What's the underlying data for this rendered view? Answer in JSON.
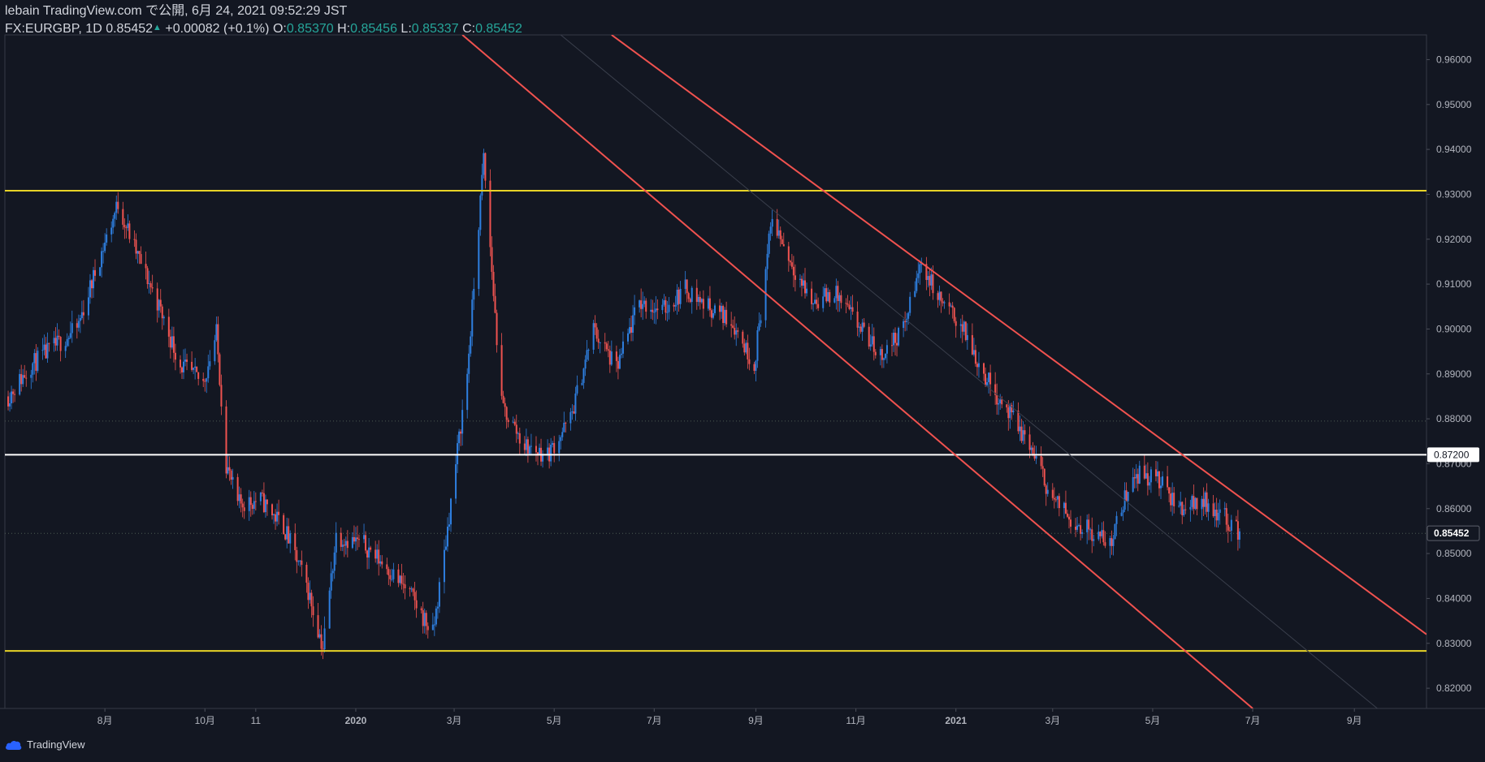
{
  "header": {
    "line1": "lebain TradingView.com で公開, 6月 24, 2021 09:52:29 JST",
    "symbol": "FX:EURGBP, 1D",
    "last": "0.85452",
    "change": "+0.00082 (+0.1%)",
    "o_label": "O:",
    "o": "0.85370",
    "h_label": "H:",
    "h": "0.85456",
    "l_label": "L:",
    "l": "0.85337",
    "c_label": "C:",
    "c": "0.85452"
  },
  "footer": {
    "brand": "TradingView"
  },
  "colors": {
    "background": "#131722",
    "up": "#2e7fe0",
    "down": "#ef5350",
    "support_resistance": "#e7d327",
    "channel": "#f0524f",
    "level_line": "#ffffff",
    "axis_text": "#b2b5be",
    "change_text": "#26a69a"
  },
  "chart_data": {
    "type": "candlestick",
    "instrument": "FX:EURGBP",
    "timeframe": "1D",
    "ylim": [
      0.8155,
      0.9655
    ],
    "y_ticks": [
      "0.96000",
      "0.95000",
      "0.94000",
      "0.93000",
      "0.92000",
      "0.91000",
      "0.90000",
      "0.89000",
      "0.88000",
      "0.87000",
      "0.86000",
      "0.85000",
      "0.84000",
      "0.83000",
      "0.82000"
    ],
    "x_ticks": [
      {
        "label": "8月",
        "date": "2019-08-01"
      },
      {
        "label": "10月",
        "date": "2019-10-01"
      },
      {
        "label": "11",
        "date": "2019-11-01"
      },
      {
        "label": "2020",
        "date": "2020-01-01"
      },
      {
        "label": "3月",
        "date": "2020-03-01"
      },
      {
        "label": "5月",
        "date": "2020-05-01"
      },
      {
        "label": "7月",
        "date": "2020-07-01"
      },
      {
        "label": "9月",
        "date": "2020-09-01"
      },
      {
        "label": "11月",
        "date": "2020-11-01"
      },
      {
        "label": "2021",
        "date": "2021-01-01"
      },
      {
        "label": "3月",
        "date": "2021-03-01"
      },
      {
        "label": "5月",
        "date": "2021-05-01"
      },
      {
        "label": "7月",
        "date": "2021-07-01"
      },
      {
        "label": "9月",
        "date": "2021-09-01"
      }
    ],
    "x_range": [
      "2019-06-01",
      "2021-10-15"
    ],
    "series": [
      {
        "date": "2019-06-03",
        "close": 0.885
      },
      {
        "date": "2019-06-17",
        "close": 0.892
      },
      {
        "date": "2019-07-01",
        "close": 0.896
      },
      {
        "date": "2019-07-15",
        "close": 0.9
      },
      {
        "date": "2019-07-29",
        "close": 0.916
      },
      {
        "date": "2019-08-09",
        "close": 0.928
      },
      {
        "date": "2019-08-19",
        "close": 0.918
      },
      {
        "date": "2019-09-02",
        "close": 0.906
      },
      {
        "date": "2019-09-16",
        "close": 0.892
      },
      {
        "date": "2019-09-30",
        "close": 0.888
      },
      {
        "date": "2019-10-08",
        "close": 0.899
      },
      {
        "date": "2019-10-14",
        "close": 0.87
      },
      {
        "date": "2019-10-21",
        "close": 0.861
      },
      {
        "date": "2019-11-04",
        "close": 0.862
      },
      {
        "date": "2019-11-18",
        "close": 0.856
      },
      {
        "date": "2019-12-02",
        "close": 0.843
      },
      {
        "date": "2019-12-12",
        "close": 0.829
      },
      {
        "date": "2019-12-20",
        "close": 0.854
      },
      {
        "date": "2020-01-06",
        "close": 0.852
      },
      {
        "date": "2020-01-20",
        "close": 0.847
      },
      {
        "date": "2020-02-03",
        "close": 0.841
      },
      {
        "date": "2020-02-17",
        "close": 0.832
      },
      {
        "date": "2020-02-24",
        "close": 0.85
      },
      {
        "date": "2020-03-09",
        "close": 0.89
      },
      {
        "date": "2020-03-19",
        "close": 0.938
      },
      {
        "date": "2020-03-30",
        "close": 0.883
      },
      {
        "date": "2020-04-13",
        "close": 0.874
      },
      {
        "date": "2020-04-27",
        "close": 0.872
      },
      {
        "date": "2020-05-11",
        "close": 0.88
      },
      {
        "date": "2020-05-25",
        "close": 0.9
      },
      {
        "date": "2020-06-08",
        "close": 0.891
      },
      {
        "date": "2020-06-22",
        "close": 0.906
      },
      {
        "date": "2020-07-06",
        "close": 0.904
      },
      {
        "date": "2020-07-20",
        "close": 0.909
      },
      {
        "date": "2020-08-03",
        "close": 0.905
      },
      {
        "date": "2020-08-17",
        "close": 0.902
      },
      {
        "date": "2020-08-31",
        "close": 0.892
      },
      {
        "date": "2020-09-11",
        "close": 0.925
      },
      {
        "date": "2020-09-21",
        "close": 0.916
      },
      {
        "date": "2020-10-05",
        "close": 0.906
      },
      {
        "date": "2020-10-19",
        "close": 0.908
      },
      {
        "date": "2020-11-02",
        "close": 0.901
      },
      {
        "date": "2020-11-16",
        "close": 0.894
      },
      {
        "date": "2020-11-30",
        "close": 0.9
      },
      {
        "date": "2020-12-11",
        "close": 0.915
      },
      {
        "date": "2020-12-21",
        "close": 0.907
      },
      {
        "date": "2021-01-04",
        "close": 0.901
      },
      {
        "date": "2021-01-18",
        "close": 0.89
      },
      {
        "date": "2021-02-01",
        "close": 0.882
      },
      {
        "date": "2021-02-15",
        "close": 0.874
      },
      {
        "date": "2021-03-01",
        "close": 0.862
      },
      {
        "date": "2021-03-15",
        "close": 0.857
      },
      {
        "date": "2021-03-29",
        "close": 0.854
      },
      {
        "date": "2021-04-05",
        "close": 0.852
      },
      {
        "date": "2021-04-19",
        "close": 0.868
      },
      {
        "date": "2021-05-03",
        "close": 0.867
      },
      {
        "date": "2021-05-17",
        "close": 0.86
      },
      {
        "date": "2021-05-31",
        "close": 0.862
      },
      {
        "date": "2021-06-14",
        "close": 0.858
      },
      {
        "date": "2021-06-23",
        "close": 0.8545
      }
    ],
    "horizontal_lines": [
      {
        "value": 0.9308,
        "kind": "support_resistance"
      },
      {
        "value": 0.872,
        "kind": "level",
        "label": "0.87200"
      },
      {
        "value": 0.8283,
        "kind": "support_resistance"
      }
    ],
    "price_label": {
      "value": 0.85452,
      "text": "0.85452"
    },
    "dotted_levels": [
      0.8795,
      0.8545
    ],
    "trend_channel": {
      "upper": {
        "start": {
          "date": "2020-06-05",
          "value": 0.9655
        },
        "end": {
          "date": "2021-10-15",
          "value": 0.832
        }
      },
      "middle": {
        "start": {
          "date": "2020-05-05",
          "value": 0.9655
        },
        "end": {
          "date": "2021-09-15",
          "value": 0.8155
        }
      },
      "lower": {
        "start": {
          "date": "2020-03-06",
          "value": 0.9655
        },
        "end": {
          "date": "2021-07-01",
          "value": 0.8155
        }
      }
    }
  }
}
